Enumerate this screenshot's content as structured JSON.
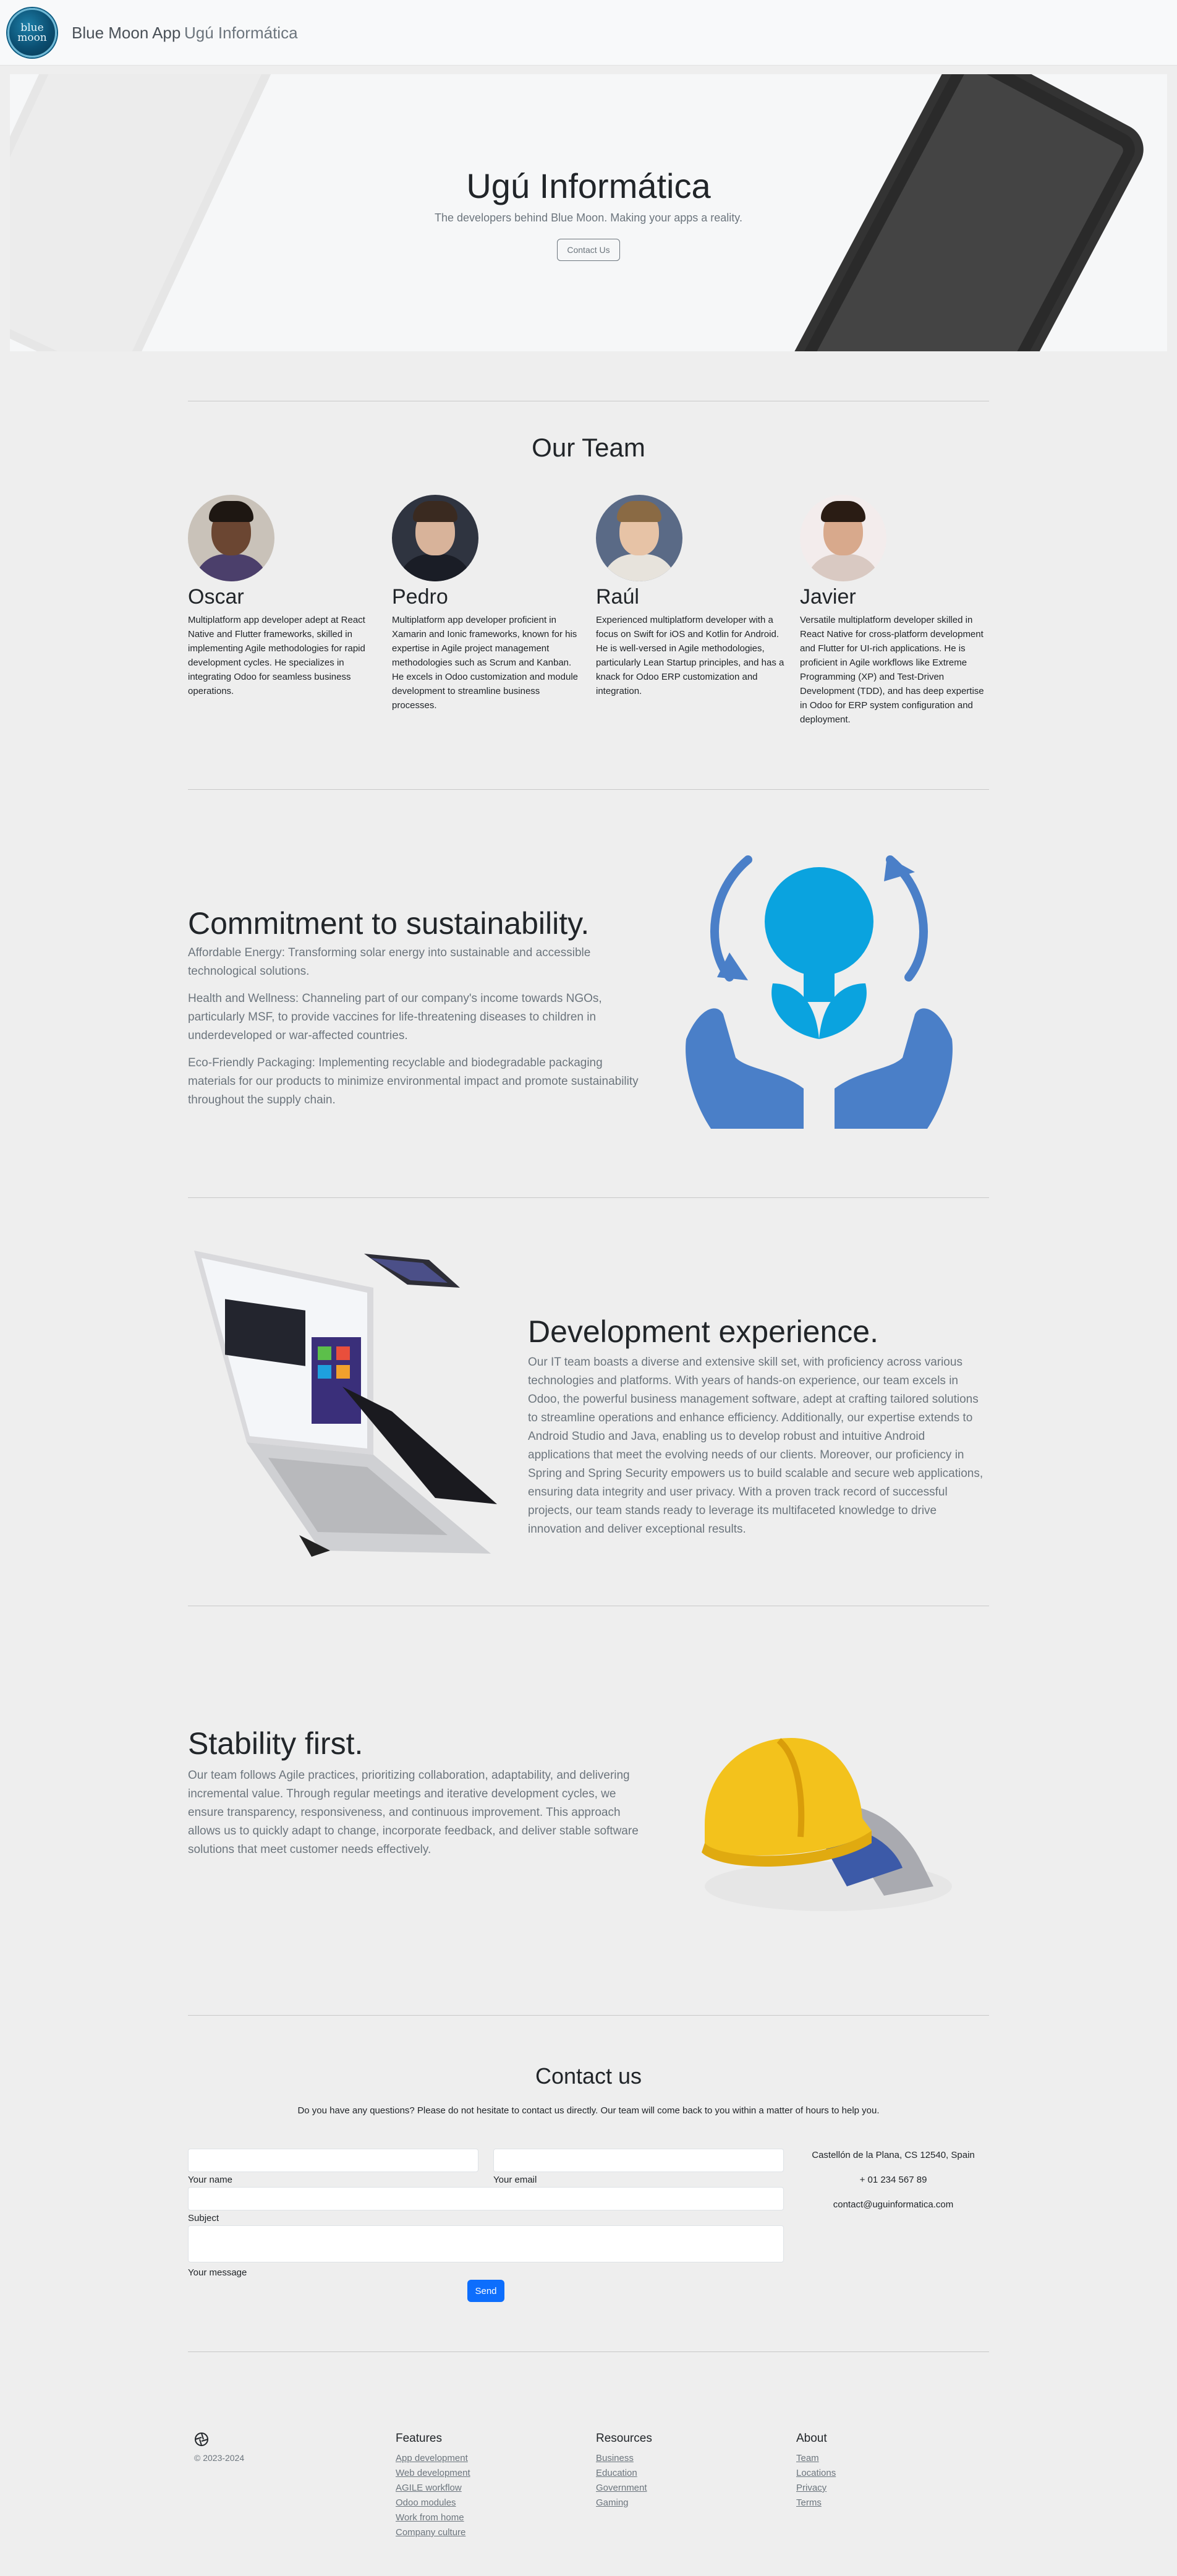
{
  "nav": {
    "logo_line1": "blue",
    "logo_line2": "moon",
    "brand": "Blue Moon App",
    "link": "Ugú Informática"
  },
  "hero": {
    "title": "Ugú Informática",
    "subtitle": "The developers behind Blue Moon. Making your apps a reality.",
    "button": "Contact Us"
  },
  "team": {
    "title": "Our Team",
    "members": [
      {
        "name": "Oscar",
        "desc": "Multiplatform app developer adept at React Native and Flutter frameworks, skilled in implementing Agile methodologies for rapid development cycles. He specializes in integrating Odoo for seamless business operations."
      },
      {
        "name": "Pedro",
        "desc": "Multiplatform app developer proficient in Xamarin and Ionic frameworks, known for his expertise in Agile project management methodologies such as Scrum and Kanban. He excels in Odoo customization and module development to streamline business processes."
      },
      {
        "name": "Raúl",
        "desc": "Experienced multiplatform developer with a focus on Swift for iOS and Kotlin for Android. He is well-versed in Agile methodologies, particularly Lean Startup principles, and has a knack for Odoo ERP customization and integration."
      },
      {
        "name": "Javier",
        "desc": "Versatile multiplatform developer skilled in React Native for cross-platform development and Flutter for UI-rich applications. He is proficient in Agile workflows like Extreme Programming (XP) and Test-Driven Development (TDD), and has deep expertise in Odoo for ERP system configuration and deployment."
      }
    ]
  },
  "sustainability": {
    "title": "Commitment to sustainability.",
    "p1": "Affordable Energy: Transforming solar energy into sustainable and accessible technological solutions.",
    "p2": "Health and Wellness: Channeling part of our company's income towards NGOs, particularly MSF, to provide vaccines for life-threatening diseases to children in underdeveloped or war-affected countries.",
    "p3": "Eco-Friendly Packaging: Implementing recyclable and biodegradable packaging materials for our products to minimize environmental impact and promote sustainability throughout the supply chain."
  },
  "development": {
    "title": "Development experience.",
    "body": "Our IT team boasts a diverse and extensive skill set, with proficiency across various technologies and platforms. With years of hands-on experience, our team excels in Odoo, the powerful business management software, adept at crafting tailored solutions to streamline operations and enhance efficiency. Additionally, our expertise extends to Android Studio and Java, enabling us to develop robust and intuitive Android applications that meet the evolving needs of our clients. Moreover, our proficiency in Spring and Spring Security empowers us to build scalable and secure web applications, ensuring data integrity and user privacy. With a proven track record of successful projects, our team stands ready to leverage its multifaceted knowledge to drive innovation and deliver exceptional results."
  },
  "stability": {
    "title": "Stability first.",
    "body": "Our team follows Agile practices, prioritizing collaboration, adaptability, and delivering incremental value. Through regular meetings and iterative development cycles, we ensure transparency, responsiveness, and continuous improvement. This approach allows us to quickly adapt to change, incorporate feedback, and deliver stable software solutions that meet customer needs effectively."
  },
  "contact": {
    "title": "Contact us",
    "lead": "Do you have any questions? Please do not hesitate to contact us directly. Our team will come back to you within a matter of hours to help you.",
    "name_label": "Your name",
    "email_label": "Your email",
    "subject_label": "Subject",
    "message_label": "Your message",
    "send": "Send",
    "address": "Castellón de la Plana, CS 12540, Spain",
    "phone": "+ 01 234 567 89",
    "email": "contact@uguinformatica.com"
  },
  "footer": {
    "copyright": "© 2023-2024",
    "columns": [
      {
        "title": "Features",
        "links": [
          "App development",
          "Web development",
          "AGILE workflow",
          "Odoo modules",
          "Work from home",
          "Company culture"
        ]
      },
      {
        "title": "Resources",
        "links": [
          "Business",
          "Education",
          "Government",
          "Gaming"
        ]
      },
      {
        "title": "About",
        "links": [
          "Team",
          "Locations",
          "Privacy",
          "Terms"
        ]
      }
    ]
  },
  "colors": {
    "primary": "#0d6efd",
    "icon_blue": "#4a7fc8",
    "bulb_blue": "#0aa3df",
    "helmet_yellow": "#f3c21c"
  }
}
